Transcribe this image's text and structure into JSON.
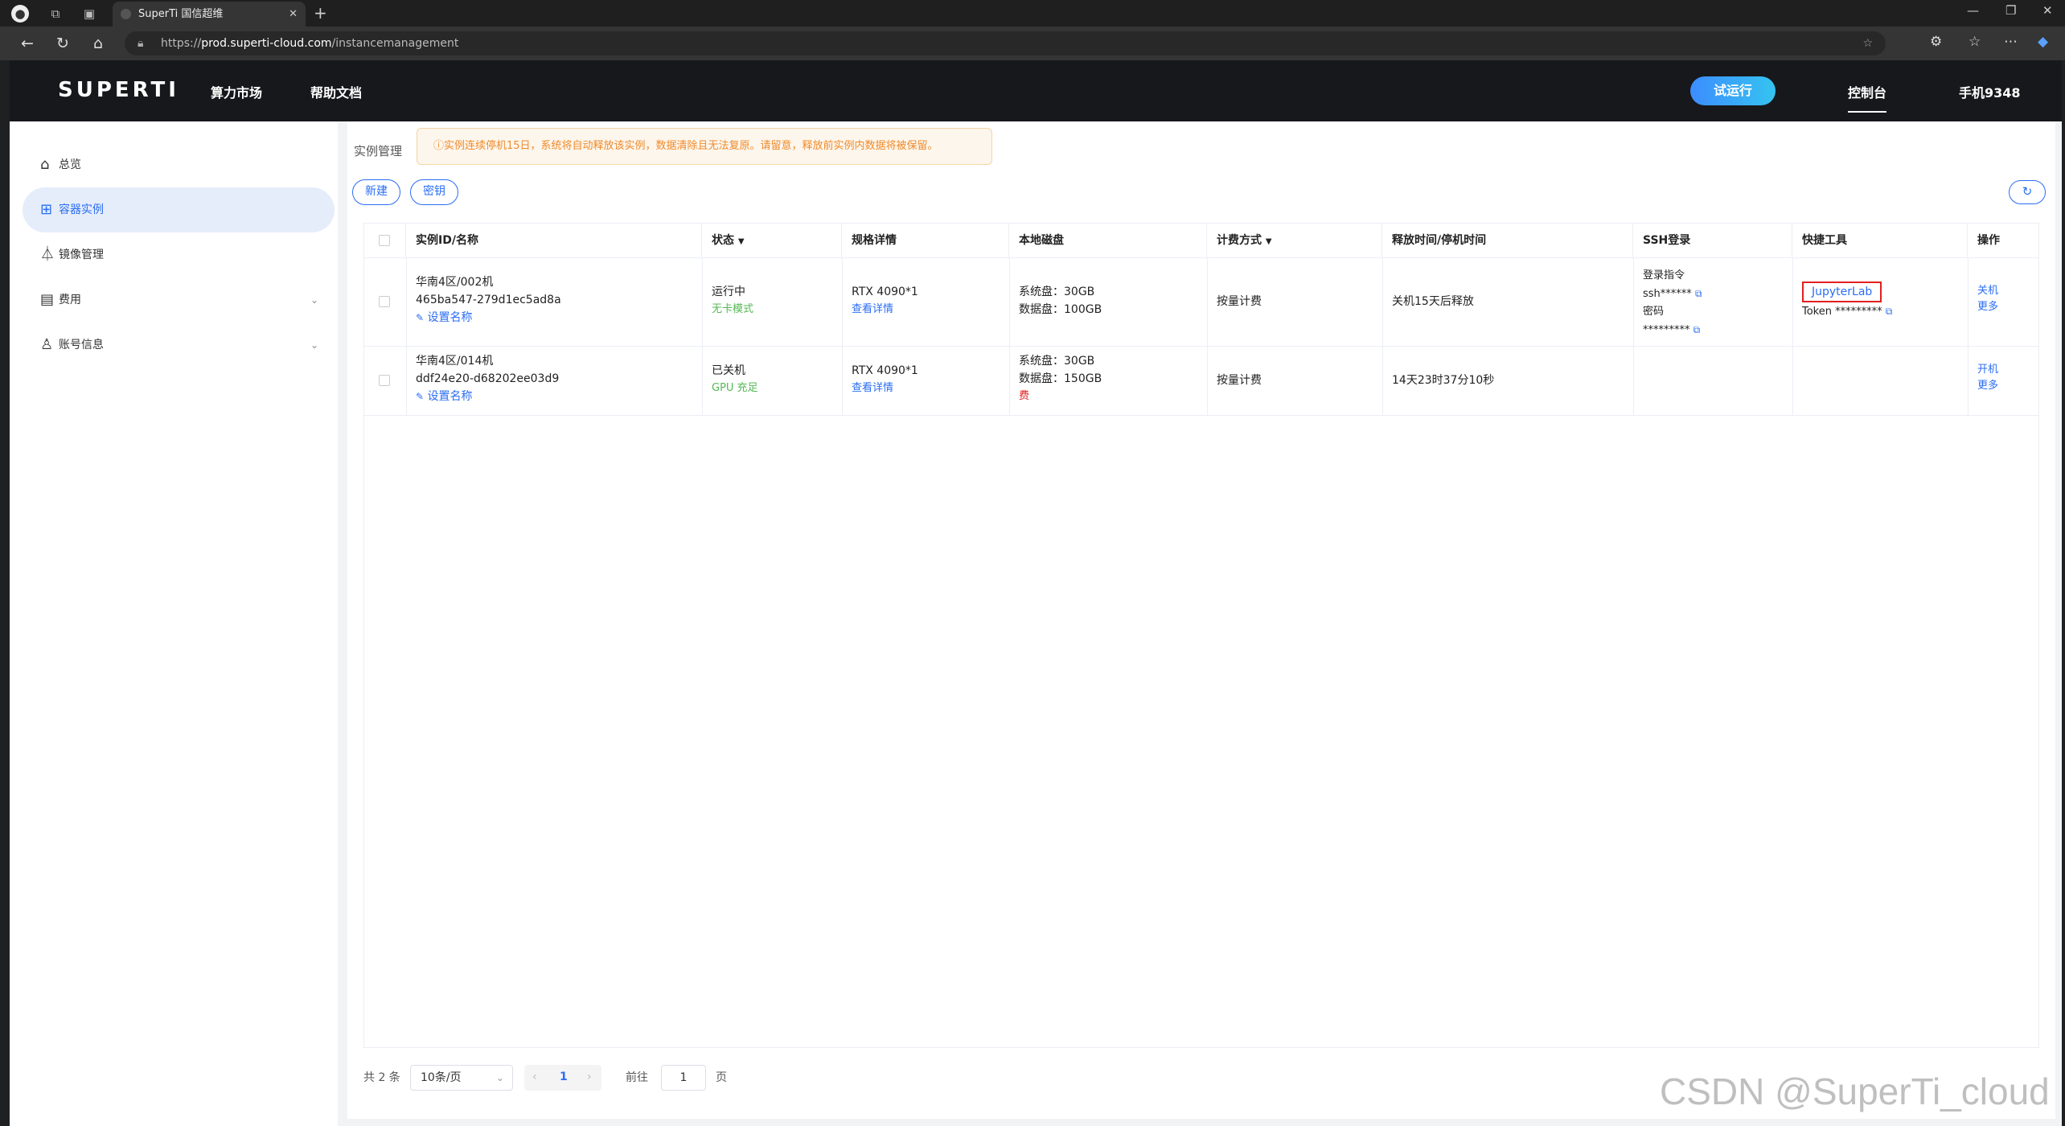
{
  "browser": {
    "tab_title": "SuperTi 国信超维",
    "url_prefix": "https://",
    "url_host": "prod.superti-cloud.com",
    "url_path": "/instancemanagement"
  },
  "header": {
    "logo": "SUPERTI",
    "nav": [
      "算力市场",
      "帮助文档"
    ],
    "try_button": "试运行",
    "console": "控制台",
    "user": "手机9348"
  },
  "sidebar": {
    "items": [
      {
        "label": "总览"
      },
      {
        "label": "容器实例"
      },
      {
        "label": "镜像管理"
      },
      {
        "label": "费用"
      },
      {
        "label": "账号信息"
      }
    ]
  },
  "main": {
    "breadcrumb": "实例管理",
    "notice": "ⓘ实例连续停机15日，系统将自动释放该实例，数据清除且无法复原。请留意，释放前实例内数据将被保留。",
    "new_button": "新建",
    "key_button": "密钥",
    "refresh_icon": "↻"
  },
  "table": {
    "columns": [
      "实例ID/名称",
      "状态",
      "规格详情",
      "本地磁盘",
      "计费方式",
      "释放时间/停机时间",
      "SSH登录",
      "快捷工具",
      "操作"
    ],
    "rows": [
      {
        "name": "华南4区/002机",
        "id": "465ba547-279d1ec5ad8a",
        "set_name": "设置名称",
        "status": "运行中",
        "mode": "无卡模式",
        "spec": "RTX 4090*1",
        "spec_link": "查看详情",
        "disk_sys": "系统盘：30GB",
        "disk_data": "数据盘：100GB",
        "billing": "按量计费",
        "release": "关机15天后释放",
        "ssh_cmd_label": "登录指令",
        "ssh_cmd": "ssh******",
        "ssh_pwd_label": "密码",
        "ssh_pwd": "*********",
        "tool": "JupyterLab",
        "token": "Token *********",
        "op1": "关机",
        "op2": "更多"
      },
      {
        "name": "华南4区/014机",
        "id": "ddf24e20-d68202ee03d9",
        "set_name": "设置名称",
        "status": "已关机",
        "mode": "GPU 充足",
        "spec": "RTX 4090*1",
        "spec_link": "查看详情",
        "disk_sys": "系统盘：30GB",
        "disk_data": "数据盘：150GB",
        "disk_fee": "费",
        "billing": "按量计费",
        "release": "14天23时37分10秒",
        "op1": "开机",
        "op2": "更多"
      }
    ]
  },
  "pagination": {
    "total": "共 2 条",
    "page_size": "10条/页",
    "current": "1",
    "goto_label": "前往",
    "goto_value": "1",
    "page_suffix": "页"
  },
  "watermark": "CSDN @SuperTi_cloud"
}
